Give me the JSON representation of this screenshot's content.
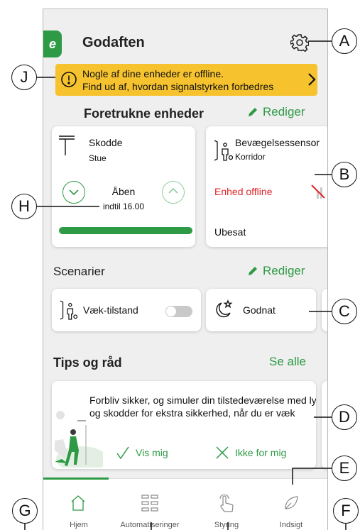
{
  "header": {
    "logo_letter": "e",
    "title": "Godaften",
    "settings_icon": "gear-icon"
  },
  "banner": {
    "line1": "Nogle af dine enheder er offline.",
    "line2": "Find ud af, hvordan signalstyrken forbedres",
    "bg_color": "#f6c22e"
  },
  "favorites": {
    "title": "Foretrukne enheder",
    "edit_label": "Rediger",
    "devices": [
      {
        "name": "Skodde",
        "room": "Stue",
        "state": "Åben",
        "state_sub": "indtil 16.00",
        "progress": 1.0,
        "icon": "shutter-icon"
      },
      {
        "name": "Bevægelsessensor",
        "room": "Korridor",
        "status": "Enhed offline",
        "state": "Ubesat",
        "icon": "motion-sensor-icon"
      }
    ]
  },
  "scenarios": {
    "title": "Scenarier",
    "edit_label": "Rediger",
    "items": [
      {
        "label": "Væk-tilstand",
        "toggle_on": false,
        "icon": "away-person-icon"
      },
      {
        "label": "Godnat",
        "icon": "moon-star-icon"
      }
    ]
  },
  "tips": {
    "title": "Tips og råd",
    "see_all": "Se alle",
    "text": "Forbliv sikker, og simuler din tilstedeværelse med lys og skodder for ekstra sikkerhed, når du er væk",
    "accept": "Vis mig",
    "decline": "Ikke for mig"
  },
  "tabs": [
    {
      "label": "Hjem",
      "active": true,
      "icon": "home-icon"
    },
    {
      "label": "Automatiseringer",
      "active": false,
      "icon": "grid-icon"
    },
    {
      "label": "Styring",
      "active": false,
      "icon": "hand-touch-icon"
    },
    {
      "label": "Indsigt",
      "active": false,
      "icon": "leaf-icon"
    }
  ],
  "callouts": [
    "A",
    "B",
    "C",
    "D",
    "E",
    "F",
    "G",
    "H",
    "J"
  ],
  "colors": {
    "accent": "#2e9a45",
    "warning": "#f6c22e",
    "error": "#e1242a"
  }
}
